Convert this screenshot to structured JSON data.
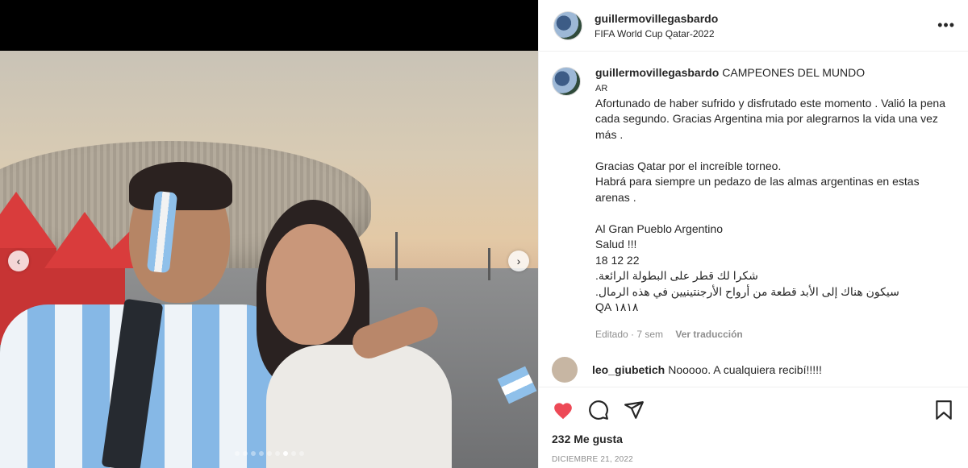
{
  "post": {
    "username": "guillermovillegasbardo",
    "location": "FIFA World Cup Qatar-2022",
    "more_label": "•••"
  },
  "caption": {
    "username": "guillermovillegasbardo",
    "headline": "CAMPEONES DEL MUNDO",
    "line_ar": "AR",
    "body": "Afortunado de haber sufrido y disfrutado este momento . Valió la pena cada segundo. Gracias Argentina mia por alegrarnos la vida una vez más .\n\nGracias Qatar por el increíble torneo.\nHabrá para siempre un pedazo de las almas argentinas en estas arenas .\n\nAl Gran Pueblo Argentino\nSalud !!!\n18 12 22\n",
    "arabic_1": "شكرا لك قطر على البطولة الرائعة.",
    "arabic_2": "سيكون هناك إلى الأبد قطعة من أرواح الأرجنتينيين في هذه الرمال.",
    "arabic_3": "QA ١٨١٨",
    "time": "Editado · 7 sem",
    "translate_label": "Ver traducción"
  },
  "next_comment": {
    "username": "leo_giubetich",
    "text": "Nooooo. A cualquiera recibí!!!!!"
  },
  "actions": {
    "likes": "232 Me gusta",
    "date": "DICIEMBRE 21, 2022"
  },
  "carousel": {
    "prev_label": "‹",
    "next_label": "›",
    "slide_count": 9,
    "active_index": 6
  },
  "colors": {
    "like_red": "#ed4956",
    "muted": "#8e8e8e"
  },
  "icons": [
    "more-options-icon",
    "heart-icon",
    "comment-icon",
    "share-icon",
    "bookmark-icon",
    "chevron-left-icon",
    "chevron-right-icon"
  ]
}
